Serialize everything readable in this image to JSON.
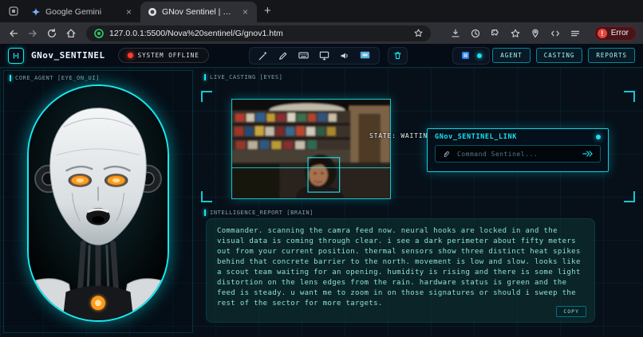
{
  "browser": {
    "tabs": [
      {
        "title": "Google Gemini"
      },
      {
        "title": "GNov Sentinel | Stable Wor"
      }
    ],
    "url": "127.0.0.1:5500/Nova%20sentinel/G/gnov1.htm",
    "error_label": "Error"
  },
  "topbar": {
    "title": "GNov_SENTINEL",
    "status": "SYSTEM OFFLINE",
    "nav": [
      {
        "label": "AGENT"
      },
      {
        "label": "CASTING"
      },
      {
        "label": "REPORTS"
      }
    ]
  },
  "core_agent": {
    "header": "CORE_AGENT [EYE_ON_UI]"
  },
  "live_casting": {
    "header": "LIVE_CASTING [EYES]",
    "state": "STATE: WAITING..."
  },
  "sentinel_link": {
    "title": "GNov_SENTINEL_LINK",
    "placeholder": "Command Sentinel..."
  },
  "intelligence_report": {
    "header": "INTELLIGENCE_REPORT [BRAIN]",
    "body": "Commander. scanning the camra feed now. neural hooks are locked in and the visual data is coming through clear. i see a dark perimeter about fifty meters out from your current position. thermal sensors show three distinct heat spikes behind that concrete barrier to the north. movement is low and slow. looks like a scout team waiting for an opening. humidity is rising and there is some light distortion on the lens edges from the rain. hardware status is green and the feed is steady. u want me to zoom in on those signatures or should i sweep the rest of the sector for more targets.",
    "copy_label": "COPY"
  },
  "colors": {
    "accent": "#19e8f0",
    "report_text": "#8fe0cd",
    "error_red": "#e8453c",
    "eye_amber": "#ff9a1f"
  }
}
